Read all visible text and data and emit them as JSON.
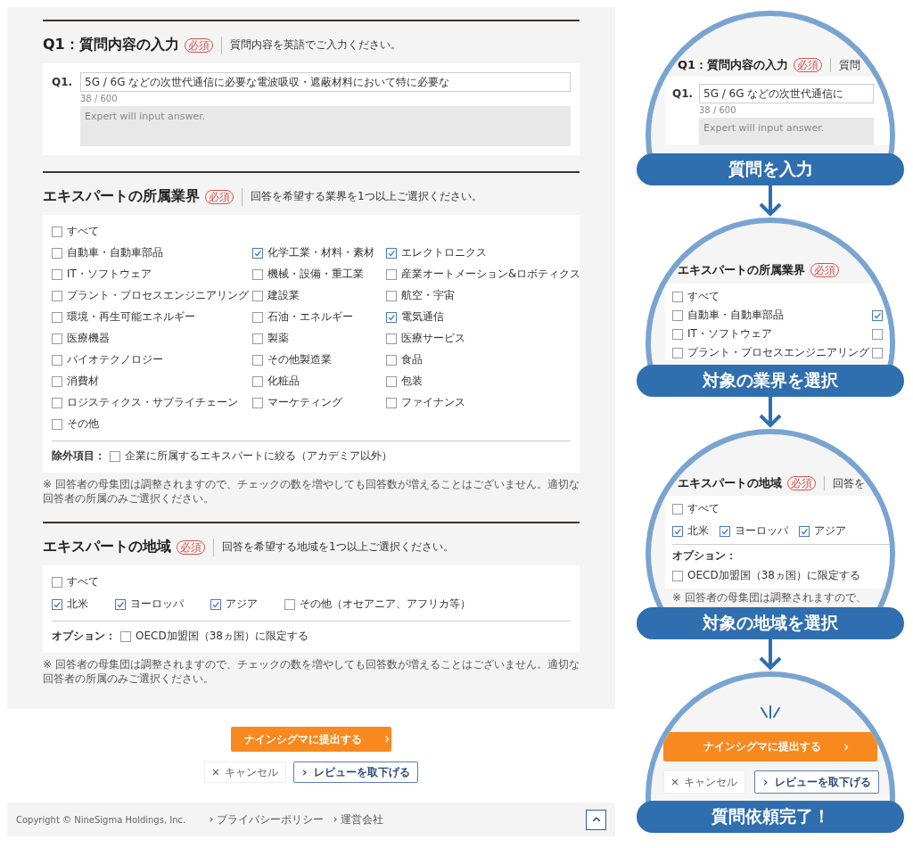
{
  "question_section": {
    "title": "Q1：質問内容の入力",
    "badge": "必須",
    "hint": "質問内容を英語でご入力ください。",
    "label": "Q1.",
    "value": "5G / 6G などの次世代通信に必要な電波吸収・遮蔽材料において特に必要な",
    "counter": "38 / 600",
    "answer_placeholder": "Expert will input answer."
  },
  "industry_section": {
    "title": "エキスパートの所属業界",
    "badge": "必須",
    "hint": "回答を希望する業界を1つ以上ご選択ください。",
    "all_option": {
      "label": "すべて",
      "checked": false
    },
    "options": [
      {
        "label": "自動車・自動車部品",
        "checked": false
      },
      {
        "label": "化学工業・材料・素材",
        "checked": true
      },
      {
        "label": "エレクトロニクス",
        "checked": true
      },
      {
        "label": "IT・ソフトウェア",
        "checked": false
      },
      {
        "label": "機械・設備・重工業",
        "checked": false
      },
      {
        "label": "産業オートメーション&ロボティクス",
        "checked": false
      },
      {
        "label": "プラント・プロセスエンジニアリング",
        "checked": false
      },
      {
        "label": "建設業",
        "checked": false
      },
      {
        "label": "航空・宇宙",
        "checked": false
      },
      {
        "label": "環境・再生可能エネルギー",
        "checked": false
      },
      {
        "label": "石油・エネルギー",
        "checked": false
      },
      {
        "label": "電気通信",
        "checked": true
      },
      {
        "label": "医療機器",
        "checked": false
      },
      {
        "label": "製薬",
        "checked": false
      },
      {
        "label": "医療サービス",
        "checked": false
      },
      {
        "label": "バイオテクノロジー",
        "checked": false
      },
      {
        "label": "その他製造業",
        "checked": false
      },
      {
        "label": "食品",
        "checked": false
      },
      {
        "label": "消費材",
        "checked": false
      },
      {
        "label": "化粧品",
        "checked": false
      },
      {
        "label": "包装",
        "checked": false
      },
      {
        "label": "ロジスティクス・サプライチェーン",
        "checked": false
      },
      {
        "label": "マーケティング",
        "checked": false
      },
      {
        "label": "ファイナンス",
        "checked": false
      },
      {
        "label": "その他",
        "checked": false
      }
    ],
    "extra": {
      "label": "除外項目：",
      "option": {
        "label": "企業に所属するエキスパートに絞る（アカデミア以外）",
        "checked": false
      }
    },
    "note": "※ 回答者の母集団は調整されますので、チェックの数を増やしても回答数が増えることはございません。適切な回答者の所属のみご選択ください。"
  },
  "region_section": {
    "title": "エキスパートの地域",
    "badge": "必須",
    "hint": "回答を希望する地域を1つ以上ご選択ください。",
    "all_option": {
      "label": "すべて",
      "checked": false
    },
    "options": [
      {
        "label": "北米",
        "checked": true
      },
      {
        "label": "ヨーロッパ",
        "checked": true
      },
      {
        "label": "アジア",
        "checked": true
      },
      {
        "label": "その他（オセアニア、アフリカ等）",
        "checked": false
      }
    ],
    "extra": {
      "label": "オプション：",
      "option": {
        "label": "OECD加盟国（38ヵ国）に限定する",
        "checked": false
      }
    },
    "note": "※ 回答者の母集団は調整されますので、チェックの数を増やしても回答数が増えることはございません。適切な回答者の所属のみご選択ください。"
  },
  "actions": {
    "submit": "ナインシグマに提出する",
    "cancel": "キャンセル",
    "withdraw": "レビューを取下げる"
  },
  "footer": {
    "copyright": "Copyright © NineSigma Holdings, Inc.",
    "links": [
      "プライバシーポリシー",
      "運営会社"
    ]
  },
  "steps": [
    {
      "kind": "question",
      "title": "Q1：質問内容の入力",
      "badge": "必須",
      "hint": "質問",
      "label": "Q1.",
      "value": "5G / 6G などの次世代通信に",
      "counter": "38 / 600",
      "answer_placeholder": "Expert will input answer.",
      "caption": "質問を入力"
    },
    {
      "kind": "industry",
      "title": "エキスパートの所属業界",
      "badge": "必須",
      "rows": [
        {
          "label": "すべて",
          "checked": false
        },
        {
          "label": "自動車・自動車部品",
          "checked": false,
          "side": {
            "checked": true
          }
        },
        {
          "label": "IT・ソフトウェア",
          "checked": false,
          "side": {
            "checked": false
          }
        },
        {
          "label": "プラント・プロセスエンジニアリング",
          "checked": false,
          "side": {
            "checked": false
          }
        }
      ],
      "caption": "対象の業界を選択"
    },
    {
      "kind": "region",
      "title": "エキスパートの地域",
      "badge": "必須",
      "hint": "回答を",
      "all_option": {
        "label": "すべて",
        "checked": false
      },
      "options": [
        {
          "label": "北米",
          "checked": true
        },
        {
          "label": "ヨーロッパ",
          "checked": true
        },
        {
          "label": "アジア",
          "checked": true
        }
      ],
      "extra": {
        "label": "オプション：",
        "option": {
          "label": "OECD加盟国（38ヵ国）に限定する",
          "checked": false
        }
      },
      "note": "※ 回答者の母集団は調整されますので、",
      "caption": "対象の地域を選択"
    },
    {
      "kind": "submit",
      "submit": "ナインシグマに提出する",
      "cancel": "キャンセル",
      "withdraw": "レビューを取下げる",
      "caption": "質問依頼完了！"
    }
  ]
}
